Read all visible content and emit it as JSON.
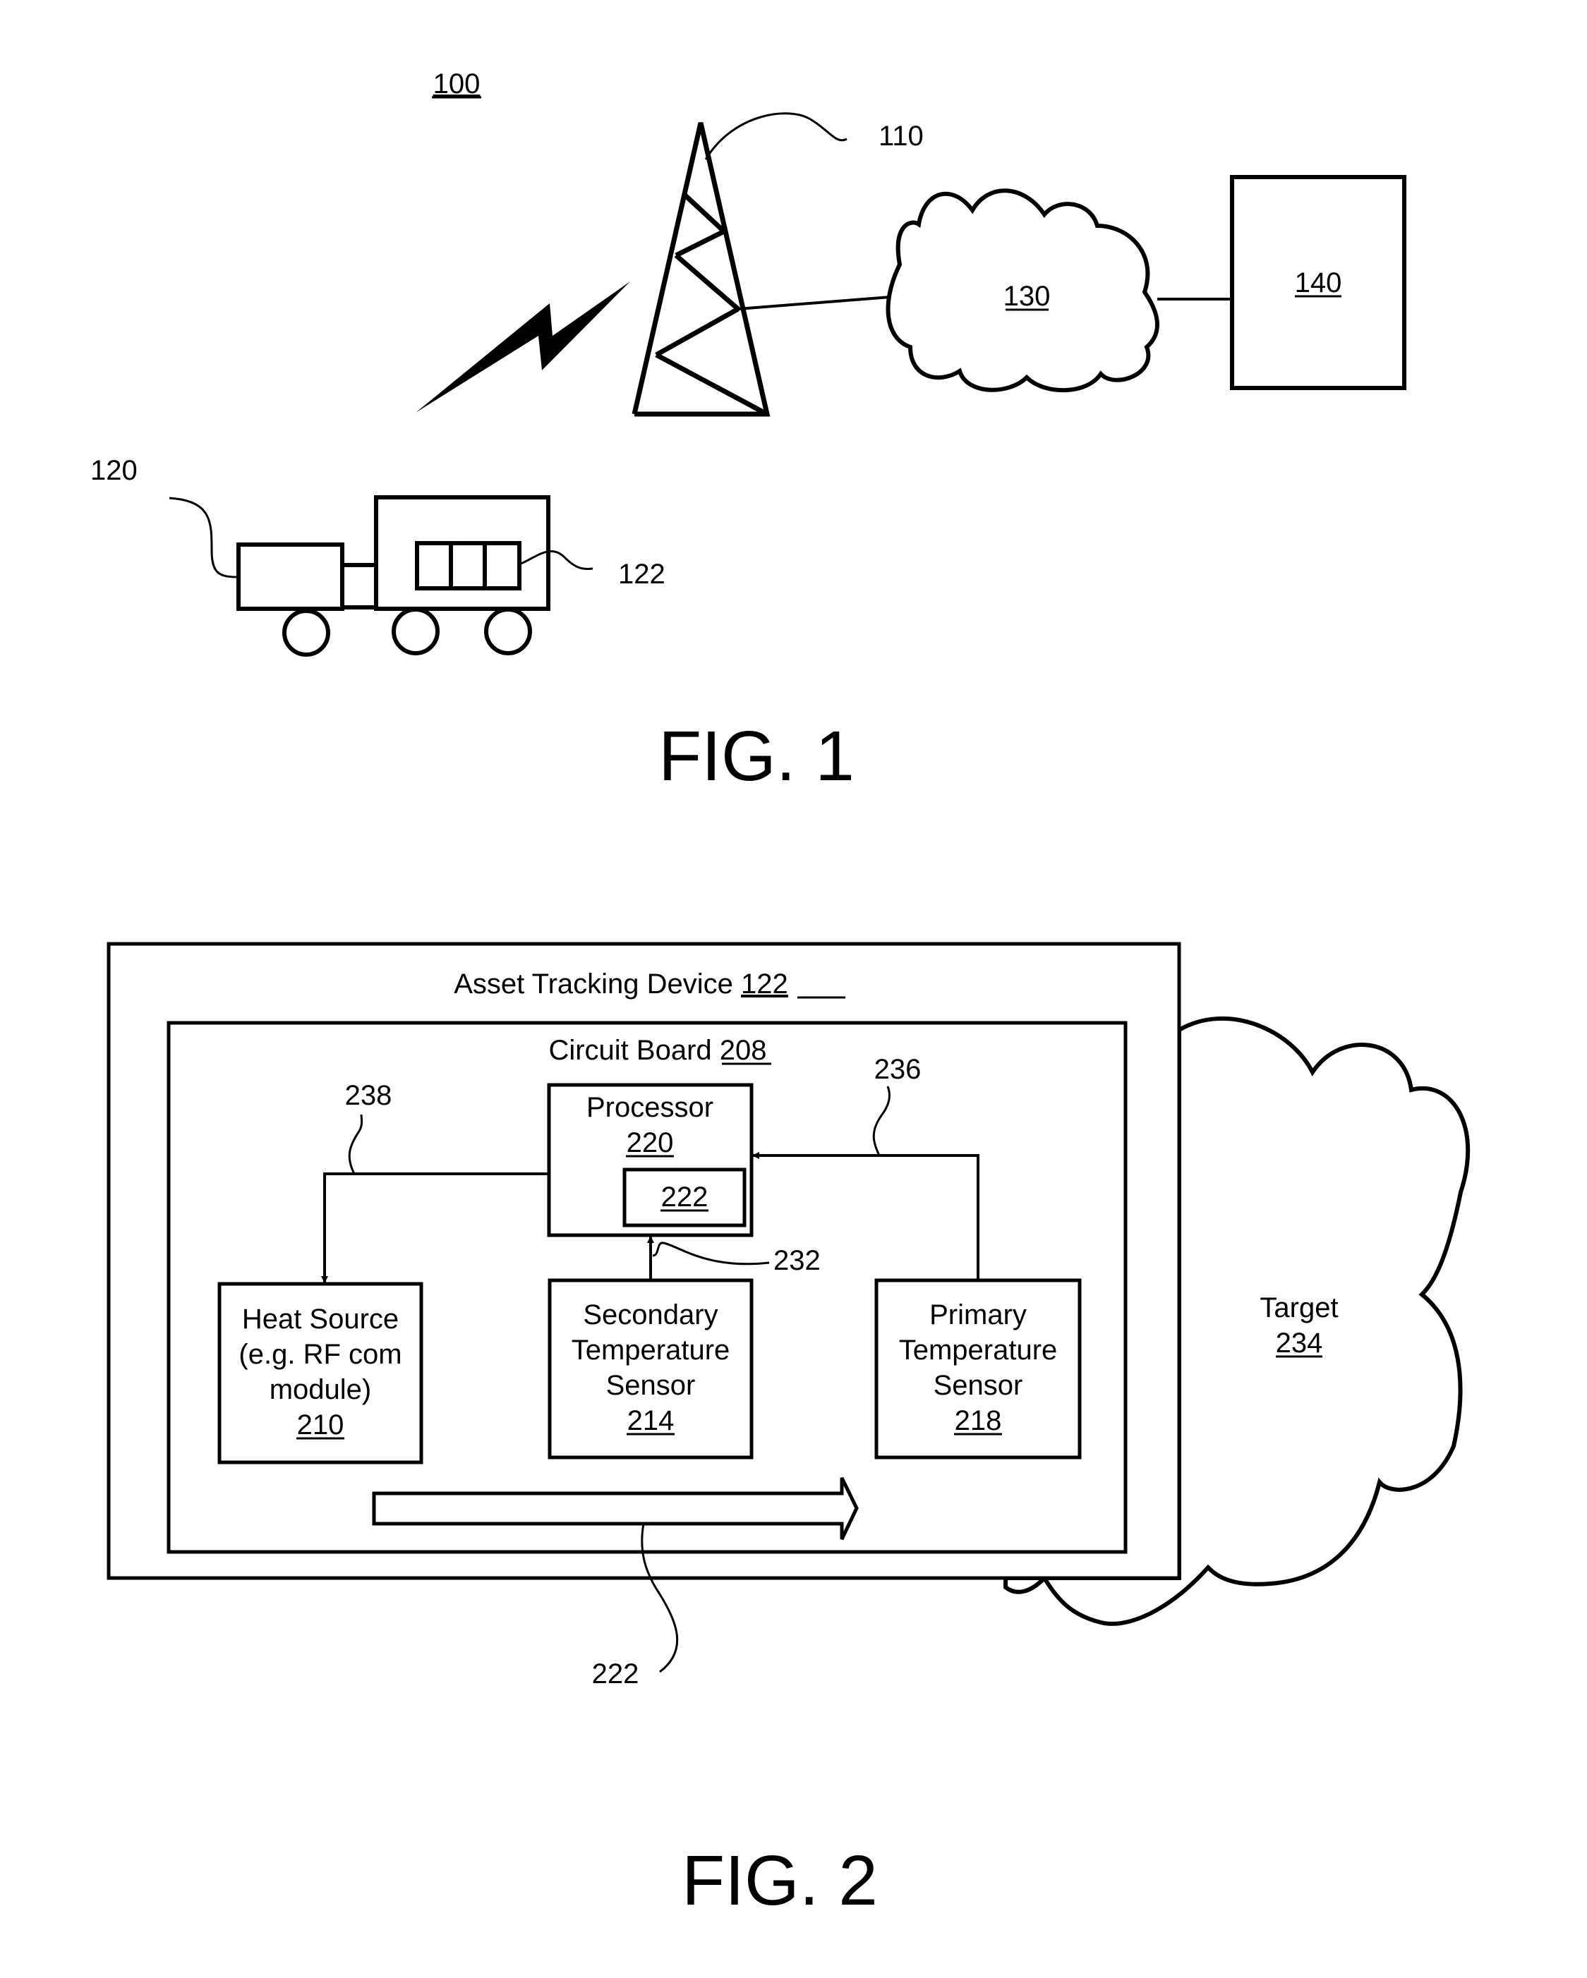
{
  "figure1": {
    "caption": "FIG. 1",
    "system_ref": "100",
    "tower_ref": "110",
    "vehicle_ref": "120",
    "device_ref": "122",
    "network_ref": "130",
    "server_ref": "140"
  },
  "figure2": {
    "caption": "FIG. 2",
    "device": {
      "label": "Asset Tracking Device",
      "ref": "122"
    },
    "circuit_board": {
      "label": "Circuit Board",
      "ref": "208"
    },
    "processor": {
      "label": "Processor",
      "ref": "220",
      "inner_ref": "222"
    },
    "heat_source": {
      "lines": [
        "Heat Source",
        "(e.g. RF com",
        "module)"
      ],
      "ref": "210"
    },
    "secondary_sensor": {
      "lines": [
        "Secondary",
        "Temperature",
        "Sensor"
      ],
      "ref": "214"
    },
    "primary_sensor": {
      "lines": [
        "Primary",
        "Temperature",
        "Sensor"
      ],
      "ref": "218"
    },
    "target": {
      "label": "Target",
      "ref": "234"
    },
    "leaders": {
      "heat_path": "238",
      "secondary_path": "232",
      "primary_path": "236",
      "heat_flow": "222"
    }
  }
}
